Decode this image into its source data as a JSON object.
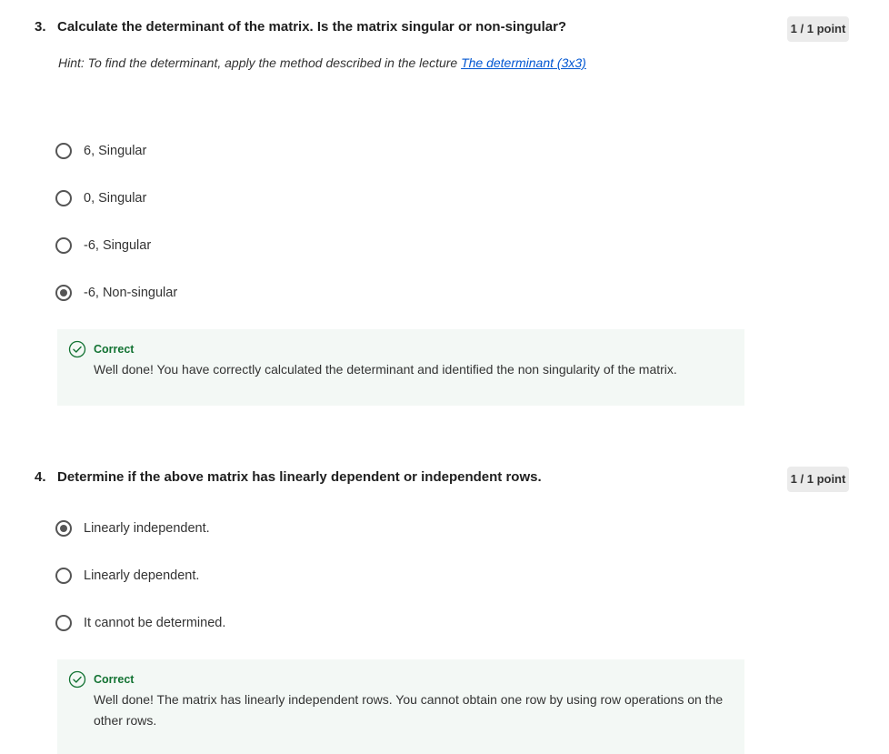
{
  "questions": [
    {
      "number": "3.",
      "text": "Calculate the determinant of the matrix. Is the matrix singular or non-singular?",
      "points": "1 / 1 point",
      "hint_prefix": "Hint: To find the determinant, apply the method described in the lecture ",
      "hint_link": "The determinant (3x3)",
      "options": [
        {
          "label": "6, Singular",
          "selected": false
        },
        {
          "label": "0, Singular",
          "selected": false
        },
        {
          "label": "-6, Singular",
          "selected": false
        },
        {
          "label": "-6, Non-singular",
          "selected": true
        }
      ],
      "feedback": {
        "status": "Correct",
        "message": "Well done! You have correctly calculated the determinant and identified the non singularity of the matrix."
      }
    },
    {
      "number": "4.",
      "text": "Determine if the above matrix has linearly dependent or independent rows.",
      "points": "1 / 1 point",
      "options": [
        {
          "label": "Linearly independent.",
          "selected": true
        },
        {
          "label": "Linearly dependent.",
          "selected": false
        },
        {
          "label": "It cannot be determined.",
          "selected": false
        }
      ],
      "feedback": {
        "status": "Correct",
        "message": "Well done! The matrix has linearly independent rows. You cannot obtain one row by using row operations on the other rows."
      }
    }
  ],
  "colors": {
    "success": "#137333",
    "feedback_bg": "#f3f8f5",
    "link": "#0056d2",
    "badge_bg": "#ebebeb"
  },
  "icons": {
    "feedback": "check-circle-icon"
  }
}
